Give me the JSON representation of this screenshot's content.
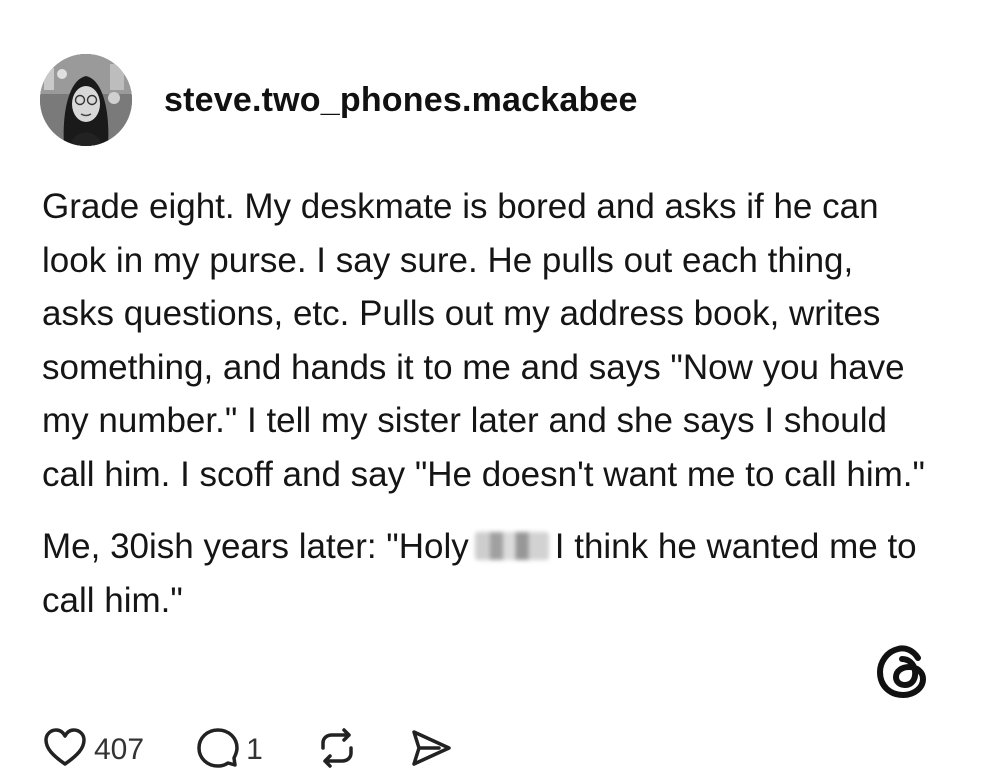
{
  "post": {
    "username": "steve.two_phones.mackabee",
    "paragraph1": "Grade eight. My deskmate is bored and asks if he can look in my purse. I say sure. He pulls out each thing, asks questions, etc. Pulls out my address book, writes something, and hands it to me and says \"Now you have my number.\" I tell my sister later and she says I should call him. I scoff and say \"He doesn't want me to call him.\"",
    "paragraph2_before": "Me, 30ish years later: \"Holy",
    "paragraph2_after": "I think he wanted me to call him.\""
  },
  "actions": {
    "like_count": "407",
    "reply_count": "1"
  },
  "icons": {
    "like": "heart-icon",
    "reply": "comment-bubble-icon",
    "repost": "repost-icon",
    "share": "send-icon",
    "brand": "threads-logo-icon"
  }
}
